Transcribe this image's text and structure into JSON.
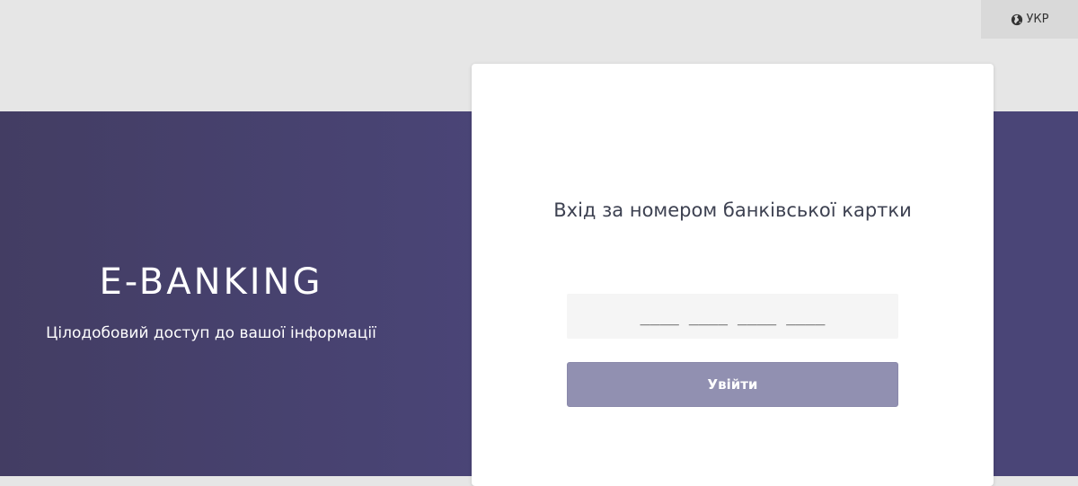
{
  "header": {
    "language_label": "УКР",
    "language_icon": "globe-icon"
  },
  "hero": {
    "brand": "E-BANKING",
    "tagline": "Цілодобовий доступ до вашої інформації"
  },
  "login": {
    "heading": "Вхід за номером банківської картки",
    "card_input": {
      "placeholder": "____ ____ ____ ____",
      "value": ""
    },
    "submit_label": "Увійти"
  },
  "colors": {
    "top_band": "#e6e6e6",
    "hero_background": "#4a4577",
    "card_background": "#ffffff",
    "button_background": "#9190b1",
    "input_background": "#f5f5f5"
  }
}
